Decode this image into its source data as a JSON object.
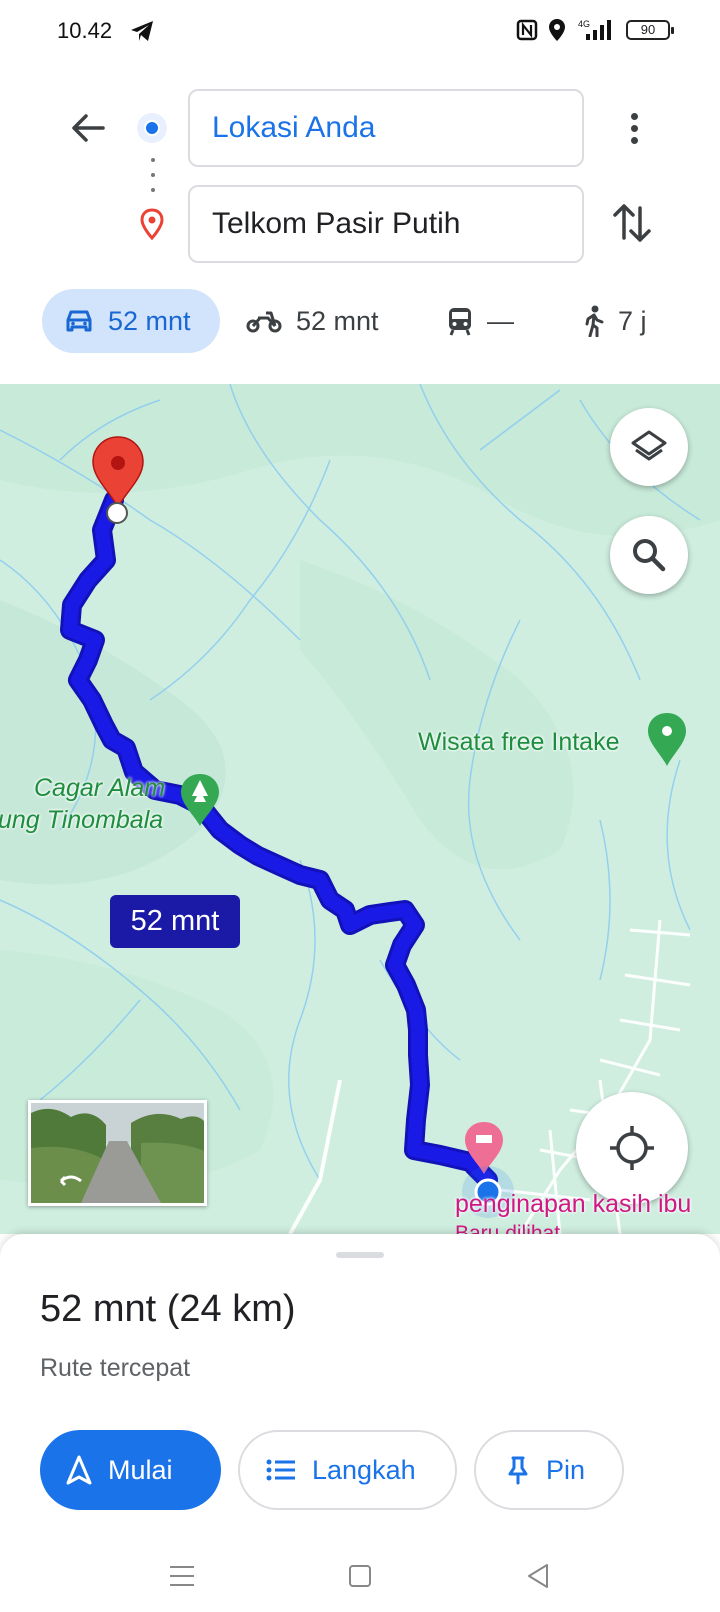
{
  "status_bar": {
    "time": "10.42",
    "battery": "90",
    "network": "4G"
  },
  "directions": {
    "origin": "Lokasi Anda",
    "destination": "Telkom Pasir Putih"
  },
  "modes": [
    {
      "name": "car",
      "label": "52 mnt",
      "active": true
    },
    {
      "name": "motorcycle",
      "label": "52 mnt"
    },
    {
      "name": "transit",
      "label": "—"
    },
    {
      "name": "walk",
      "label": "7 j"
    }
  ],
  "map": {
    "labels": {
      "wisata": "Wisata free Intake",
      "cagar_line1": "Cagar Alam",
      "cagar_line2": "ung Tinombala",
      "hotel": "penginapan kasih ibu",
      "hotel_sub": "Baru dilihat"
    },
    "eta_bubble": "52 mnt",
    "route_color": "#1a1ae6"
  },
  "sheet": {
    "summary": "52 mnt (24 km)",
    "subtitle": "Rute tercepat",
    "start_label": "Mulai",
    "steps_label": "Langkah",
    "pin_label": "Pin"
  },
  "colors": {
    "accent": "#1a73e8",
    "route": "#1a1ae6",
    "destination_pin": "#ea4335",
    "park": "#1e8e3e",
    "hotel": "#d01884"
  },
  "icons": [
    "back-arrow-icon",
    "more-vert-icon",
    "swap-icon",
    "car-icon",
    "motorcycle-icon",
    "transit-icon",
    "walk-icon",
    "layers-icon",
    "search-icon",
    "my-location-icon",
    "navigation-icon",
    "list-icon",
    "pin-icon"
  ]
}
